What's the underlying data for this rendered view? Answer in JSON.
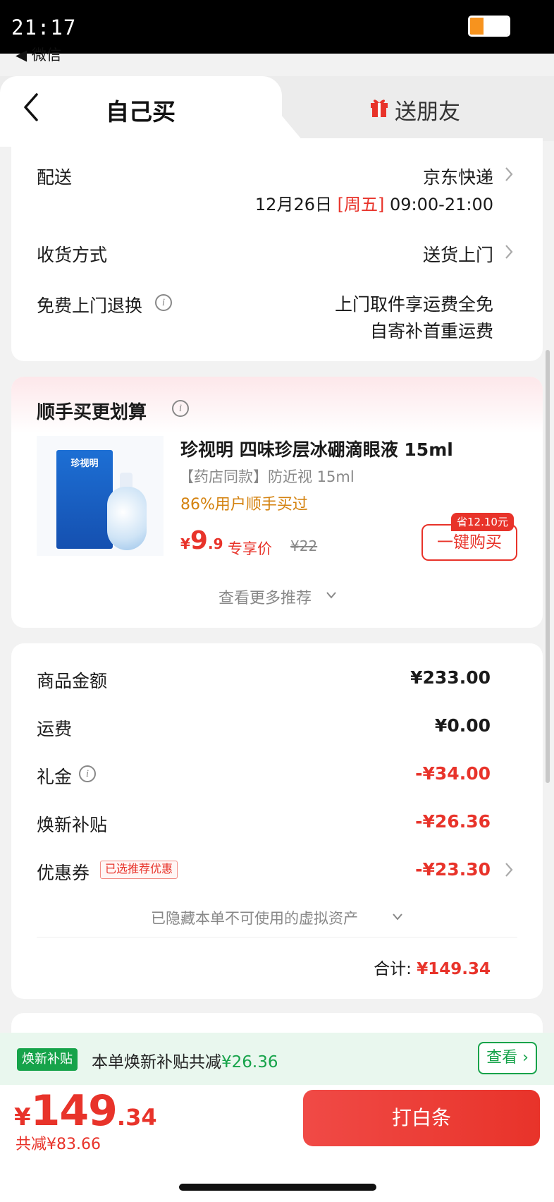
{
  "status_bar": {
    "time": "21:17",
    "battery_level": 0.35
  },
  "back_app": {
    "label": "◀ 微信"
  },
  "tabs": {
    "self": "自己买",
    "friend": "送朋友"
  },
  "delivery": {
    "label": "配送",
    "carrier": "京东快递",
    "date": "12月26日",
    "weekday": "[周五]",
    "time_range": "09:00-21:00"
  },
  "receive": {
    "label": "收货方式",
    "value": "送货上门"
  },
  "free_return": {
    "label": "免费上门退换",
    "line1": "上门取件享运费全免",
    "line2": "自寄补首重运费"
  },
  "addon": {
    "title": "顺手买更划算",
    "product_name": "珍视明 四味珍层冰硼滴眼液 15ml",
    "product_spec": "【药店同款】防近视 15ml",
    "product_stat": "86%用户顺手买过",
    "price_symbol": "¥",
    "price_int": "9",
    "price_dec": ".9",
    "price_label": "专享价",
    "orig_price": "¥22",
    "save_tag": "省12.10元",
    "buy_button": "一键购买",
    "more": "查看更多推荐",
    "box_label": "珍视明"
  },
  "summary": {
    "goods_label": "商品金额",
    "goods_value": "¥233.00",
    "shipping_label": "运费",
    "shipping_value": "¥0.00",
    "gift_label": "礼金",
    "gift_value": "-¥34.00",
    "subsidy_label": "焕新补贴",
    "subsidy_value": "-¥26.36",
    "coupon_label": "优惠券",
    "coupon_tag": "已选推荐优惠",
    "coupon_value": "-¥23.30",
    "hidden_assets": "已隐藏本单不可使用的虚拟资产",
    "total_label": "合计:",
    "total_value": "¥149.34"
  },
  "banner": {
    "tag": "焕新补贴",
    "text": "本单焕新补贴共减",
    "amount": "¥26.36",
    "button": "查看"
  },
  "footer": {
    "symbol": "¥",
    "price_int": "149",
    "price_dec": ".34",
    "discount": "共减¥83.66",
    "pay_button": "打白条"
  },
  "colors": {
    "accent_red": "#e8332a",
    "green": "#16a34a",
    "orange": "#d4820f"
  }
}
